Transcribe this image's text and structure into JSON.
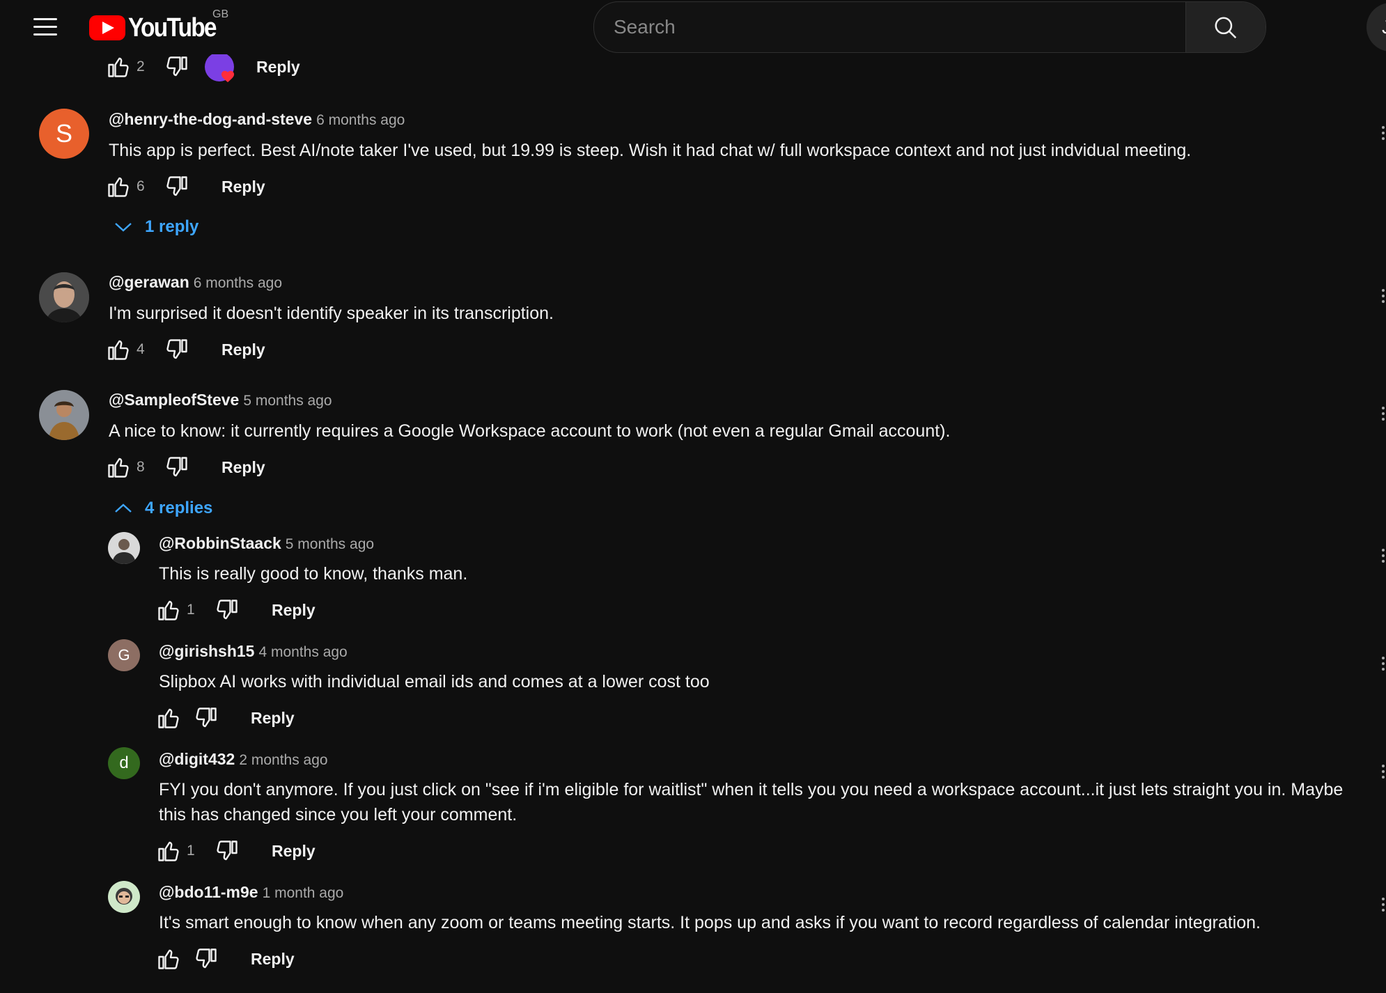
{
  "header": {
    "logo_text": "YouTube",
    "country_code": "GB",
    "search_placeholder": "Search",
    "account_initial": "J"
  },
  "colors": {
    "background": "#0f0f0f",
    "brand_red": "#ff0000",
    "link_blue": "#3ea6ff",
    "muted_text": "#aaaaaa"
  },
  "top_partial": {
    "like_count": "2",
    "reply_label": "Reply"
  },
  "comments": [
    {
      "author": "@henry-the-dog-and-steve",
      "time": "6 months ago",
      "text": "This app is perfect.  Best AI/note taker I've used, but 19.99 is steep.  Wish it had chat w/ full workspace context and not just indvidual meeting.",
      "likes": "6",
      "reply_label": "Reply",
      "avatar_letter": "S",
      "avatar_color": "#e8602c",
      "replies_toggle": "1 reply"
    },
    {
      "author": "@gerawan",
      "time": "6 months ago",
      "text": "I'm surprised it doesn't identify speaker in its transcription.",
      "likes": "4",
      "reply_label": "Reply"
    },
    {
      "author": "@SampleofSteve",
      "time": "5 months ago",
      "text": "A nice to know: it currently requires a Google Workspace account to work (not even a regular Gmail account).",
      "likes": "8",
      "reply_label": "Reply",
      "replies_toggle": "4 replies"
    }
  ],
  "replies": [
    {
      "author": "@RobbinStaack",
      "time": "5 months ago",
      "text": "This is really good to know, thanks man.",
      "likes": "1",
      "reply_label": "Reply"
    },
    {
      "author": "@girishsh15",
      "time": "4 months ago",
      "text": "Slipbox AI works with individual email ids and comes at a lower cost too",
      "likes": "",
      "reply_label": "Reply",
      "avatar_letter": "G",
      "avatar_color": "#8d6e63"
    },
    {
      "author": "@digit432",
      "time": "2 months ago",
      "text": "FYI you don't anymore. If you just click on \"see if i'm eligible for waitlist\" when it tells you you need a workspace account...it just lets straight you in. Maybe this has changed since you left your comment.",
      "likes": "1",
      "reply_label": "Reply",
      "avatar_letter": "d",
      "avatar_color": "#33691e"
    },
    {
      "author": "@bdo11-m9e",
      "time": "1 month ago",
      "text": "It's smart enough to know when any zoom or teams meeting starts. It pops up and asks if you want to record regardless of calendar integration.",
      "likes": "",
      "reply_label": "Reply"
    }
  ]
}
